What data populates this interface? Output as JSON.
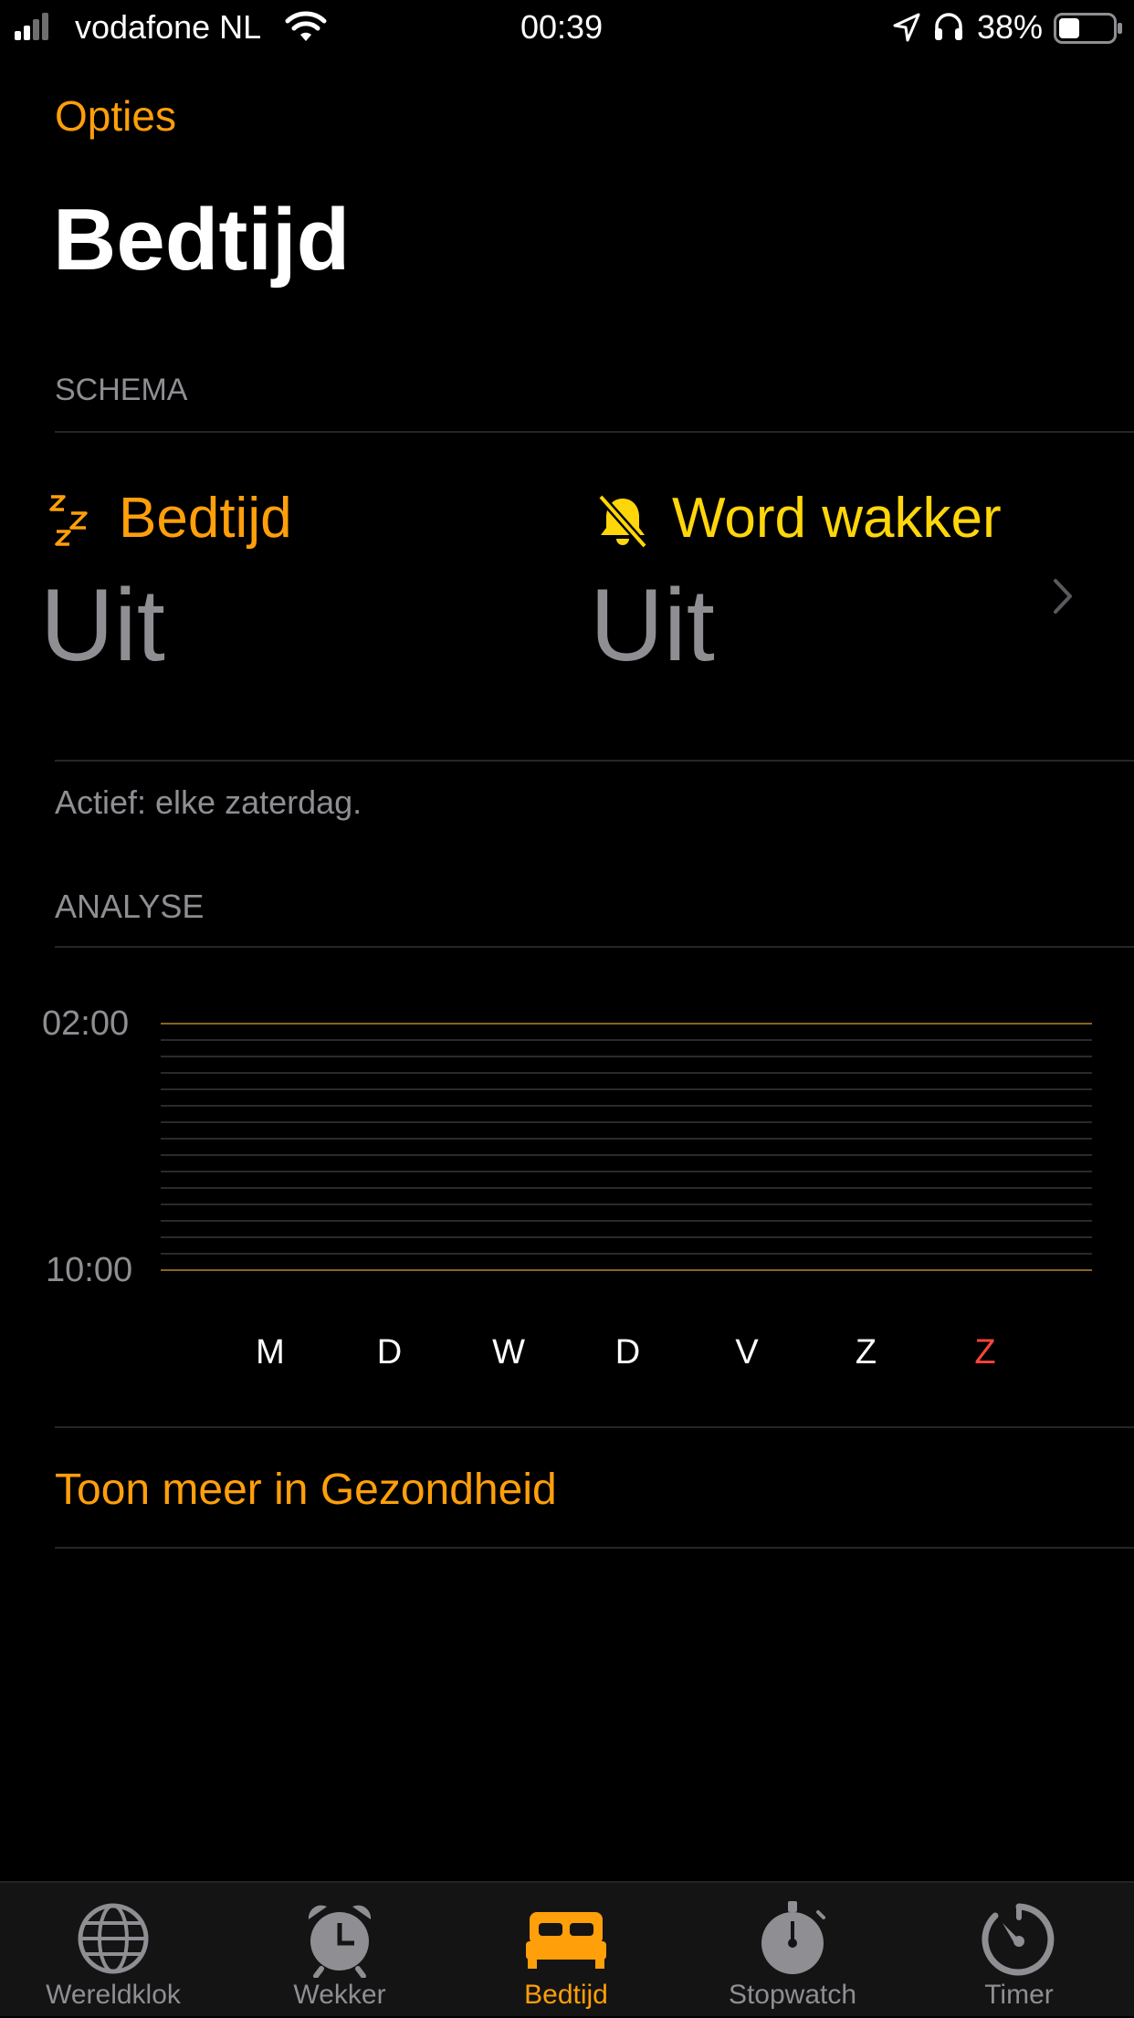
{
  "status_bar": {
    "carrier": "vodafone NL",
    "time": "00:39",
    "battery": "38%",
    "battery_level": 0.38
  },
  "nav": {
    "options_label": "Opties"
  },
  "page": {
    "title": "Bedtijd"
  },
  "schedule": {
    "section_label": "SCHEMA",
    "bedtime_label": "Bedtijd",
    "bedtime_value": "Uit",
    "wake_label": "Word wakker",
    "wake_value": "Uit",
    "active_text": "Actief: elke zaterdag."
  },
  "analysis": {
    "section_label": "ANALYSE",
    "y_top": "02:00",
    "y_bottom": "10:00",
    "days": [
      "M",
      "D",
      "W",
      "D",
      "V",
      "Z",
      "Z"
    ],
    "highlight_day_index": 6
  },
  "health_link": "Toon meer in Gezondheid",
  "tabs": [
    {
      "label": "Wereldklok",
      "icon": "globe-icon",
      "active": false
    },
    {
      "label": "Wekker",
      "icon": "alarm-clock-icon",
      "active": false
    },
    {
      "label": "Bedtijd",
      "icon": "bed-icon",
      "active": true
    },
    {
      "label": "Stopwatch",
      "icon": "stopwatch-icon",
      "active": false
    },
    {
      "label": "Timer",
      "icon": "timer-icon",
      "active": false
    }
  ],
  "colors": {
    "accent": "#ff9f0a",
    "bell": "#ffd60a",
    "highlight_day": "#ff453a"
  }
}
